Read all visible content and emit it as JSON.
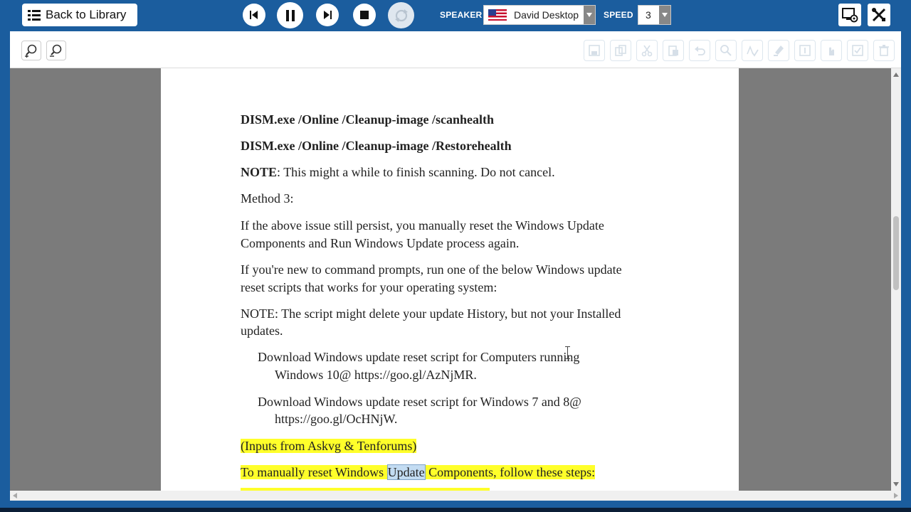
{
  "topbar": {
    "back_label": "Back to Library",
    "speaker_label": "SPEAKER",
    "speaker_value": "David Desktop",
    "speed_label": "SPEED",
    "speed_value": "3"
  },
  "document": {
    "cmd1": "DISM.exe /Online /Cleanup-image /scanhealth",
    "cmd2": "DISM.exe /Online /Cleanup-image /Restorehealth",
    "note_bold": "NOTE",
    "note_text": ": This might a while to finish scanning. Do not cancel.",
    "method": "Method 3:",
    "para1_l1": "If the above issue still persist, you manually reset the Windows Update",
    "para1_l2": "Components and Run Windows Update process again.",
    "para2_l1": "If you're new to command prompts, run one of the below Windows update",
    "para2_l2": "reset scripts that works for your operating system:",
    "note2_l1": "NOTE: The script might delete your update History, but not your Installed",
    "note2_l2": "updates.",
    "dl1_l1": "Download Windows update reset script for Computers running",
    "dl1_l2": "Windows 10@ https://goo.gl/AzNjMR.",
    "dl2_l1": "Download Windows update reset script for Windows 7 and 8@",
    "dl2_l2": "https://goo.gl/OcHNjW.",
    "inputs": "(Inputs from Askvg & Tenforums)",
    "steps_pre": "To manually reset Windows ",
    "steps_sel": "Update",
    "steps_post": " Components, follow these steps:"
  },
  "colors": {
    "header": "#1b5d9e",
    "highlight": "#ffff2a",
    "selection": "#c3dcf2"
  }
}
